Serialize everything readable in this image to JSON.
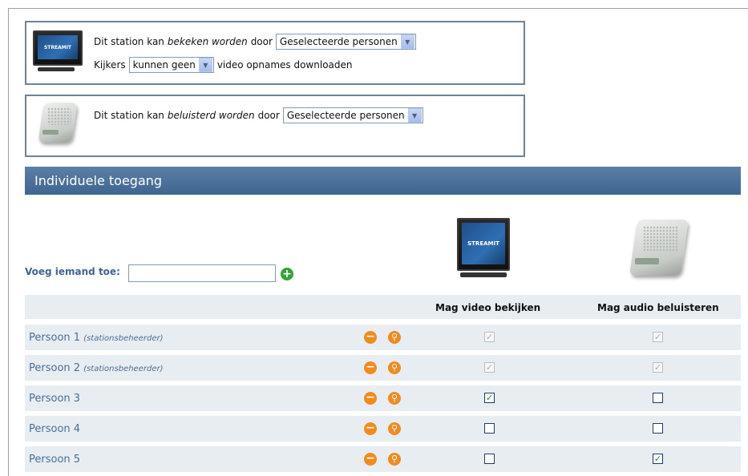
{
  "box1": {
    "line1_prefix": "Dit station kan",
    "line1_emph": "bekeken worden",
    "line1_suffix": "door",
    "line1_select": "Geselecteerde personen",
    "line2_prefix": "Kijkers",
    "line2_select": "kunnen geen",
    "line2_suffix": "video opnames downloaden"
  },
  "box2": {
    "line1_prefix": "Dit station kan",
    "line1_emph": "beluisterd worden",
    "line1_suffix": "door",
    "line1_select": "Geselecteerde personen"
  },
  "tv_logo": "STREAMIT",
  "section_header": "Individuele toegang",
  "add": {
    "label": "Voeg iemand toe:",
    "value": ""
  },
  "table": {
    "headers": [
      "Mag video bekijken",
      "Mag audio beluisteren"
    ],
    "rows": [
      {
        "name": "Persoon 1",
        "role": "(stationsbeheerder)",
        "video": true,
        "audio": true,
        "disabled": true
      },
      {
        "name": "Persoon 2",
        "role": "(stationsbeheerder)",
        "video": true,
        "audio": true,
        "disabled": true
      },
      {
        "name": "Persoon 3",
        "role": "",
        "video": true,
        "audio": false,
        "disabled": false
      },
      {
        "name": "Persoon 4",
        "role": "",
        "video": false,
        "audio": false,
        "disabled": false
      },
      {
        "name": "Persoon 5",
        "role": "",
        "video": false,
        "audio": true,
        "disabled": false
      }
    ]
  },
  "icons": {
    "add": "plus-circle-icon",
    "remove": "minus-circle-icon",
    "search": "search-icon",
    "dropdown": "chevron-down-icon"
  },
  "colors": {
    "header": "#3f6590",
    "row_bg": "#e8edf2",
    "add_button": "#39a236",
    "action_icons": "#f28b1e",
    "name_text": "#4a6f95"
  }
}
